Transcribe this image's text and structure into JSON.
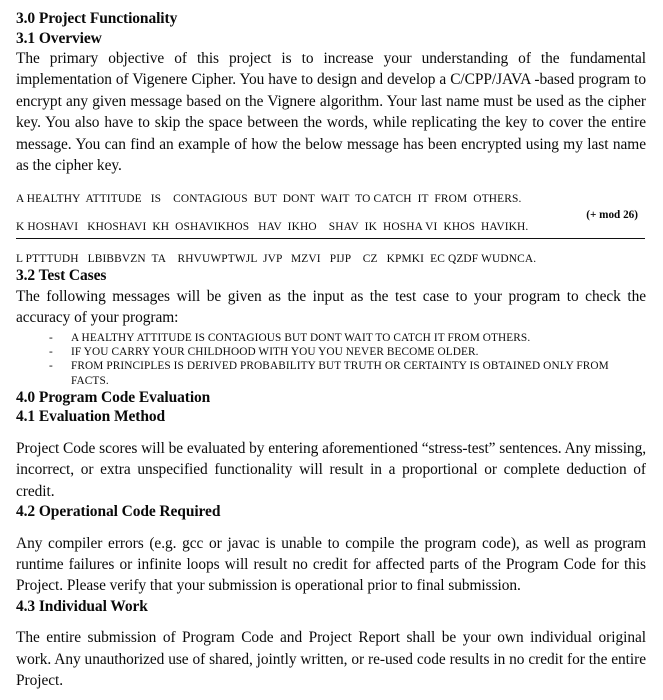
{
  "document": {
    "sections": [
      {
        "id": "3.0",
        "heading": "3.0 Project Functionality"
      },
      {
        "id": "3.1",
        "heading": "3.1 Overview",
        "paragraph": "The primary objective of this project is to increase your understanding of the fundamental implementation of Vigenere Cipher. You have to design and develop a C/CPP/JAVA -based program to encrypt any given message based on the Vignere algorithm. Your last name must  be used as the cipher key. You also have to skip the space between the words, while replicating the key to cover the entire message. You can find an example of how the below message has been encrypted using my last name as the cipher key."
      },
      {
        "id": "3.2",
        "heading": "3.2 Test Cases",
        "paragraph": "The following messages will be given as the input as the test case to your program to check the accuracy of your program:"
      },
      {
        "id": "4.0",
        "heading": "4.0 Program Code Evaluation"
      },
      {
        "id": "4.1",
        "heading": "4.1 Evaluation Method",
        "paragraph": "Project Code scores will be evaluated by entering aforementioned “stress-test” sentences. Any missing, incorrect, or extra unspecified functionality will result in a proportional or complete deduction of credit."
      },
      {
        "id": "4.2",
        "heading": "4.2 Operational Code Required",
        "paragraph": "Any compiler errors (e.g. gcc or javac is unable to compile the program code), as well as program runtime failures or infinite loops will result no credit for affected parts of the Program Code for this Project.  Please verify that your submission is operational prior to final submission."
      },
      {
        "id": "4.3",
        "heading": "4.3 Individual Work",
        "paragraph": "The entire submission of Program Code and Project Report shall be your own individual original work.  Any unauthorized use of shared, jointly written, or re-used code results in no credit for the entire Project."
      }
    ],
    "cipher_example": {
      "plaintext_line": "A HEALTHY  ATTITUDE   IS    CONTAGIOUS  BUT  DONT  WAIT  TO CATCH  IT  FROM  OTHERS.",
      "key_line": "K HOSHAVI   KHOSHAVI  KH  OSHAVIKHOS   HAV  IKHO    SHAV  IK  HOSHA VI  KHOS  HAVIKH.",
      "operator_label": "(+ mod 26)",
      "ciphertext_line": "L PTTTUDH   LBIBBVZN  TA    RHVUWPTWJL  JVP   MZVI   PIJP    CZ   KPMKI  EC QZDF WUDNCA."
    },
    "test_cases": {
      "marker": "-",
      "items": [
        "A HEALTHY  ATTITUDE   IS    CONTAGIOUS  BUT  DONT  WAIT  TO CATCH  IT  FROM  OTHERS.",
        "IF  YOU  CARRY  YOUR  CHILDHOOD  WITH  YOU  YOU   NEVER   BECOME  OLDER.",
        "FROM PRINCIPLES IS DERIVED PROBABILITY BUT TRUTH OR CERTAINTY IS OBTAINED ONLY FROM\nFACTS."
      ]
    },
    "colors": {
      "page_background": "#ffffff",
      "text": "#0a0a0a",
      "rule": "#111111"
    }
  }
}
